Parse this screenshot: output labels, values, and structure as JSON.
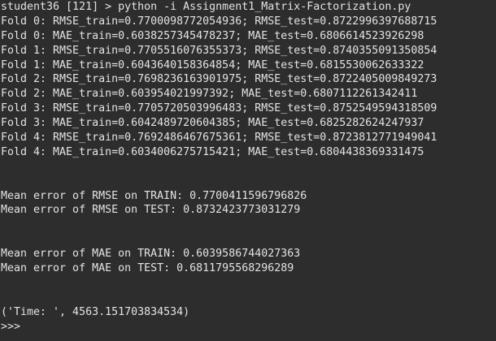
{
  "terminal": {
    "command_line": "student36 [121] > python -i Assignment1_Matrix-Factorization.py",
    "folds": [
      "Fold 0: RMSE_train=0.7700098772054936; RMSE_test=0.8722996397688715",
      "Fold 0: MAE_train=0.6038257345478237; MAE_test=0.6806614523926298",
      "Fold 1: RMSE_train=0.7705516076355373; RMSE_test=0.8740355091350854",
      "Fold 1: MAE_train=0.6043640158364854; MAE_test=0.6815530062633322",
      "Fold 2: RMSE_train=0.7698236163901975; RMSE_test=0.8722405009849273",
      "Fold 2: MAE_train=0.603954021997392; MAE_test=0.6807112261342411",
      "Fold 3: RMSE_train=0.7705720503996483; RMSE_test=0.8752549594318509",
      "Fold 3: MAE_train=0.6042489720604385; MAE_test=0.6825282624247937",
      "Fold 4: RMSE_train=0.7692486467675361; RMSE_test=0.8723812771949041",
      "Fold 4: MAE_train=0.6034006275715421; MAE_test=0.6804438369331475"
    ],
    "rmse_train_mean": "Mean error of RMSE on TRAIN: 0.7700411596796826",
    "rmse_test_mean": "Mean error of RMSE on TEST: 0.8732423773031279",
    "mae_train_mean": "Mean error of MAE on TRAIN: 0.6039586744027363",
    "mae_test_mean": "Mean error of MAE on TEST: 0.6811795568296289",
    "time_output": "('Time: ', 4563.151703834534)",
    "prompt": ">>>"
  },
  "colors": {
    "background": "#2d2d2d",
    "foreground": "#e3e3e3"
  }
}
